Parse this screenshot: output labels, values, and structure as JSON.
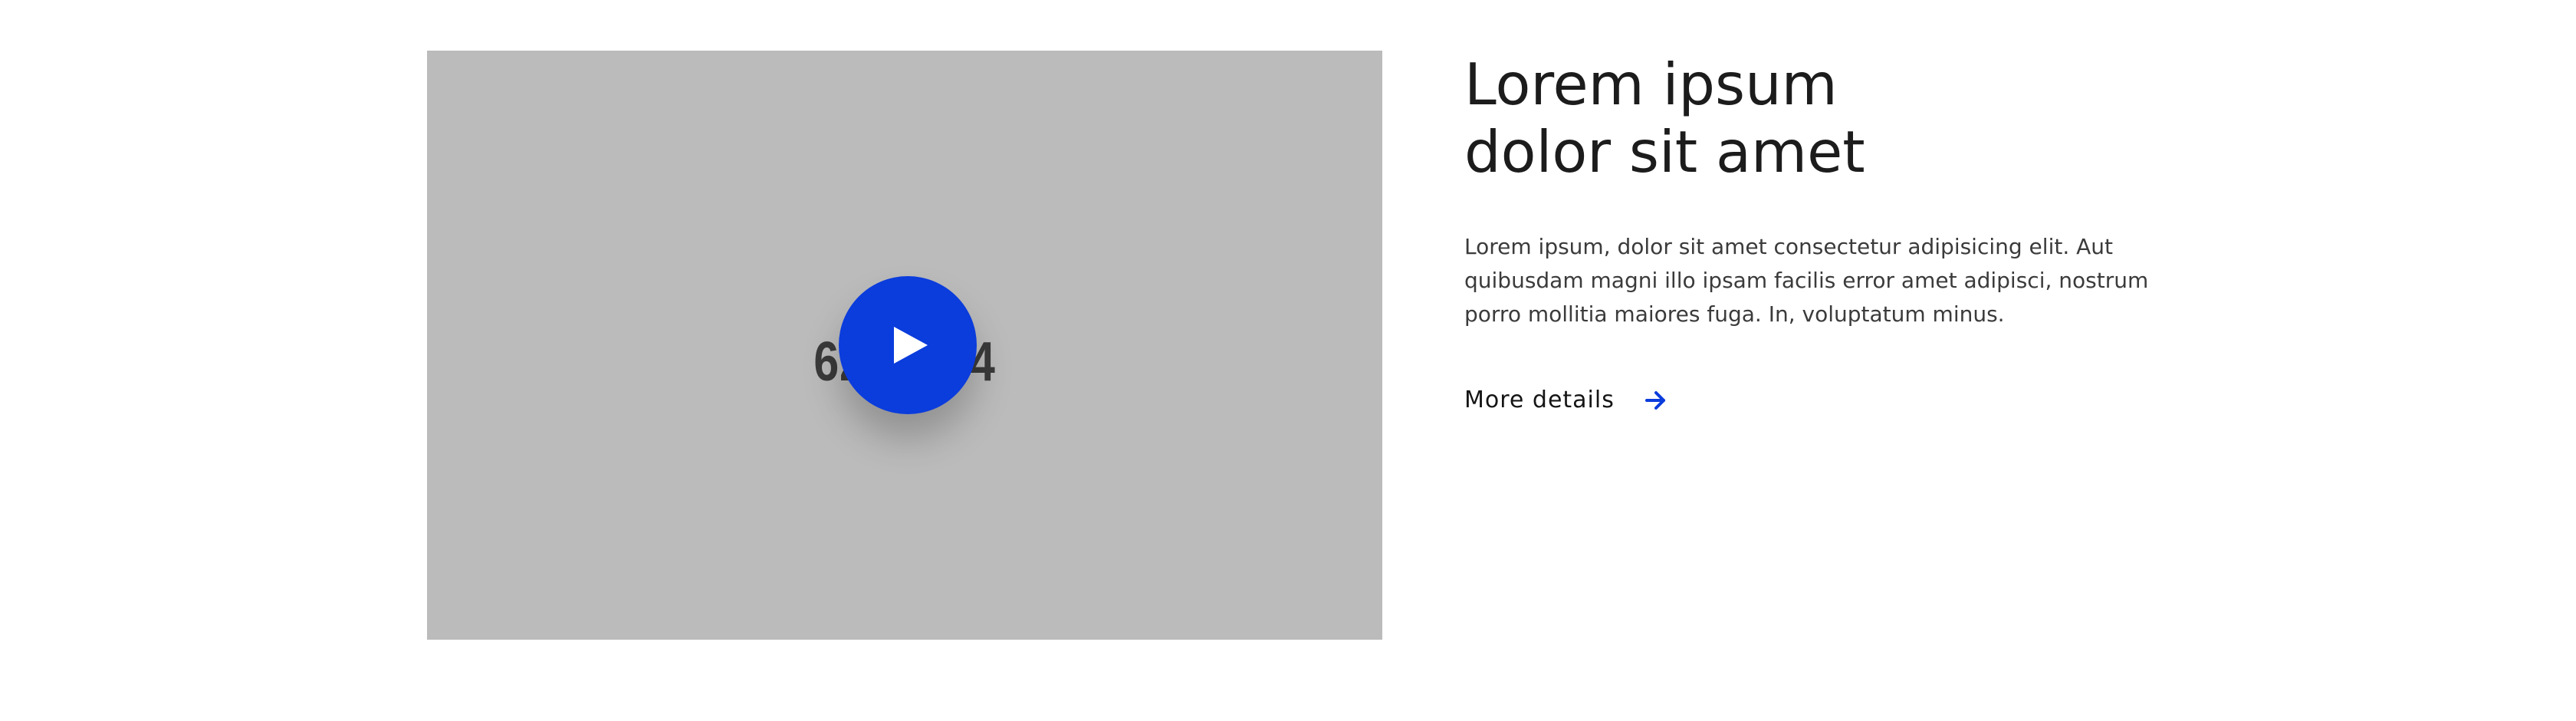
{
  "video": {
    "placeholder_text": "620×384",
    "play_icon": "play-icon"
  },
  "content": {
    "title": "Lorem ipsum dolor sit amet",
    "body": "Lorem ipsum, dolor sit amet consectetur adipisicing elit. Aut quibusdam magni illo ipsam facilis error amet adipisci, nostrum porro mollitia maiores fuga. In, voluptatum minus.",
    "link_label": "More details",
    "link_icon": "arrow-right-icon"
  },
  "colors": {
    "accent": "#0b3cdc",
    "video_bg": "#bbbbbb",
    "title": "#1c1c1c",
    "body": "#3b3b3b"
  }
}
